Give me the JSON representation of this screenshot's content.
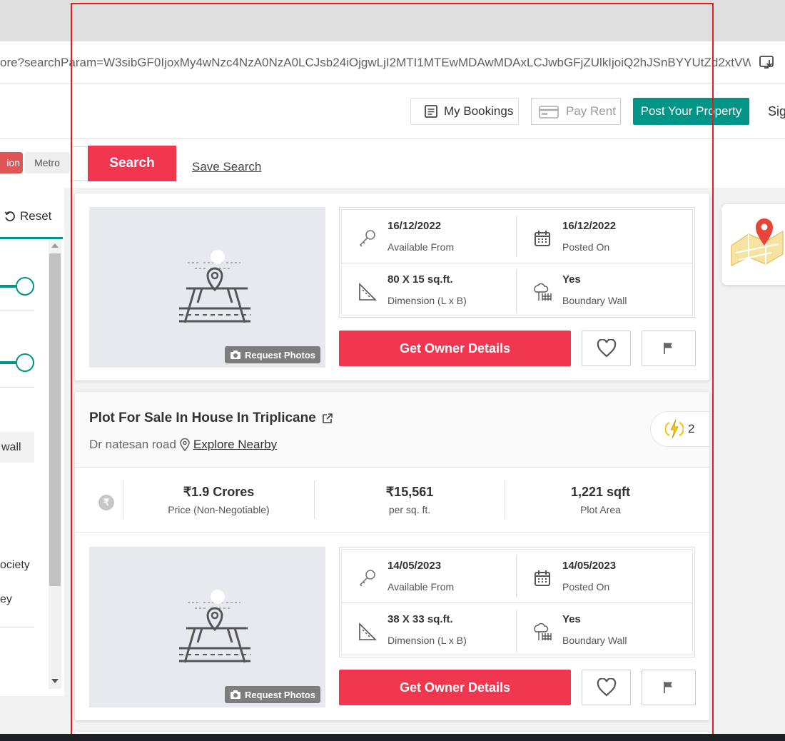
{
  "browser": {
    "url": "ore?searchParam=W3sibGF0IjoxMy4wNzc4NzA0NzA0LCJsb24iOjgwLjI2MTI1MTEwMDAwMDAxLCJwbGFjZUlkIjoiQ2hJSnBYYUtZd2xtVWpvUm..."
  },
  "header": {
    "my_bookings": "My Bookings",
    "pay_rent": "Pay Rent",
    "post_property": "Post Your Property",
    "sign_in": "Sig"
  },
  "search": {
    "seg_active": "ion",
    "seg_metro": "Metro",
    "search_button": "Search",
    "save_search": "Save Search"
  },
  "filters": {
    "reset": "Reset",
    "chip_wall": " wall",
    "society": "ociety",
    "ey": "ey"
  },
  "listings": [
    {
      "request_photos": "Request Photos",
      "available_from": "16/12/2022",
      "available_from_label": "Available From",
      "posted_on": "16/12/2022",
      "posted_on_label": "Posted On",
      "dimension": "80 X 15 sq.ft.",
      "dimension_label": "Dimension (L x B)",
      "boundary_wall": "Yes",
      "boundary_wall_label": "Boundary Wall",
      "owner_button": "Get Owner Details"
    },
    {
      "title": "Plot For Sale In House In Triplicane",
      "street": "Dr natesan road",
      "explore": "Explore Nearby",
      "boost_count": "2",
      "price": "₹1.9 Crores",
      "price_label": "Price (Non-Negotiable)",
      "per_sqft": "₹15,561",
      "per_sqft_label": "per sq. ft.",
      "area": "1,221 sqft",
      "area_label": "Plot Area",
      "request_photos": "Request Photos",
      "available_from": "14/05/2023",
      "available_from_label": "Available From",
      "posted_on": "14/05/2023",
      "posted_on_label": "Posted On",
      "dimension": "38 X 33 sq.ft.",
      "dimension_label": "Dimension (L x B)",
      "boundary_wall": "Yes",
      "boundary_wall_label": "Boundary Wall",
      "owner_button": "Get Owner Details"
    }
  ],
  "colors": {
    "brand_teal": "#009587",
    "cta_red": "#f1374f",
    "highlight_frame": "#e21d1d"
  }
}
